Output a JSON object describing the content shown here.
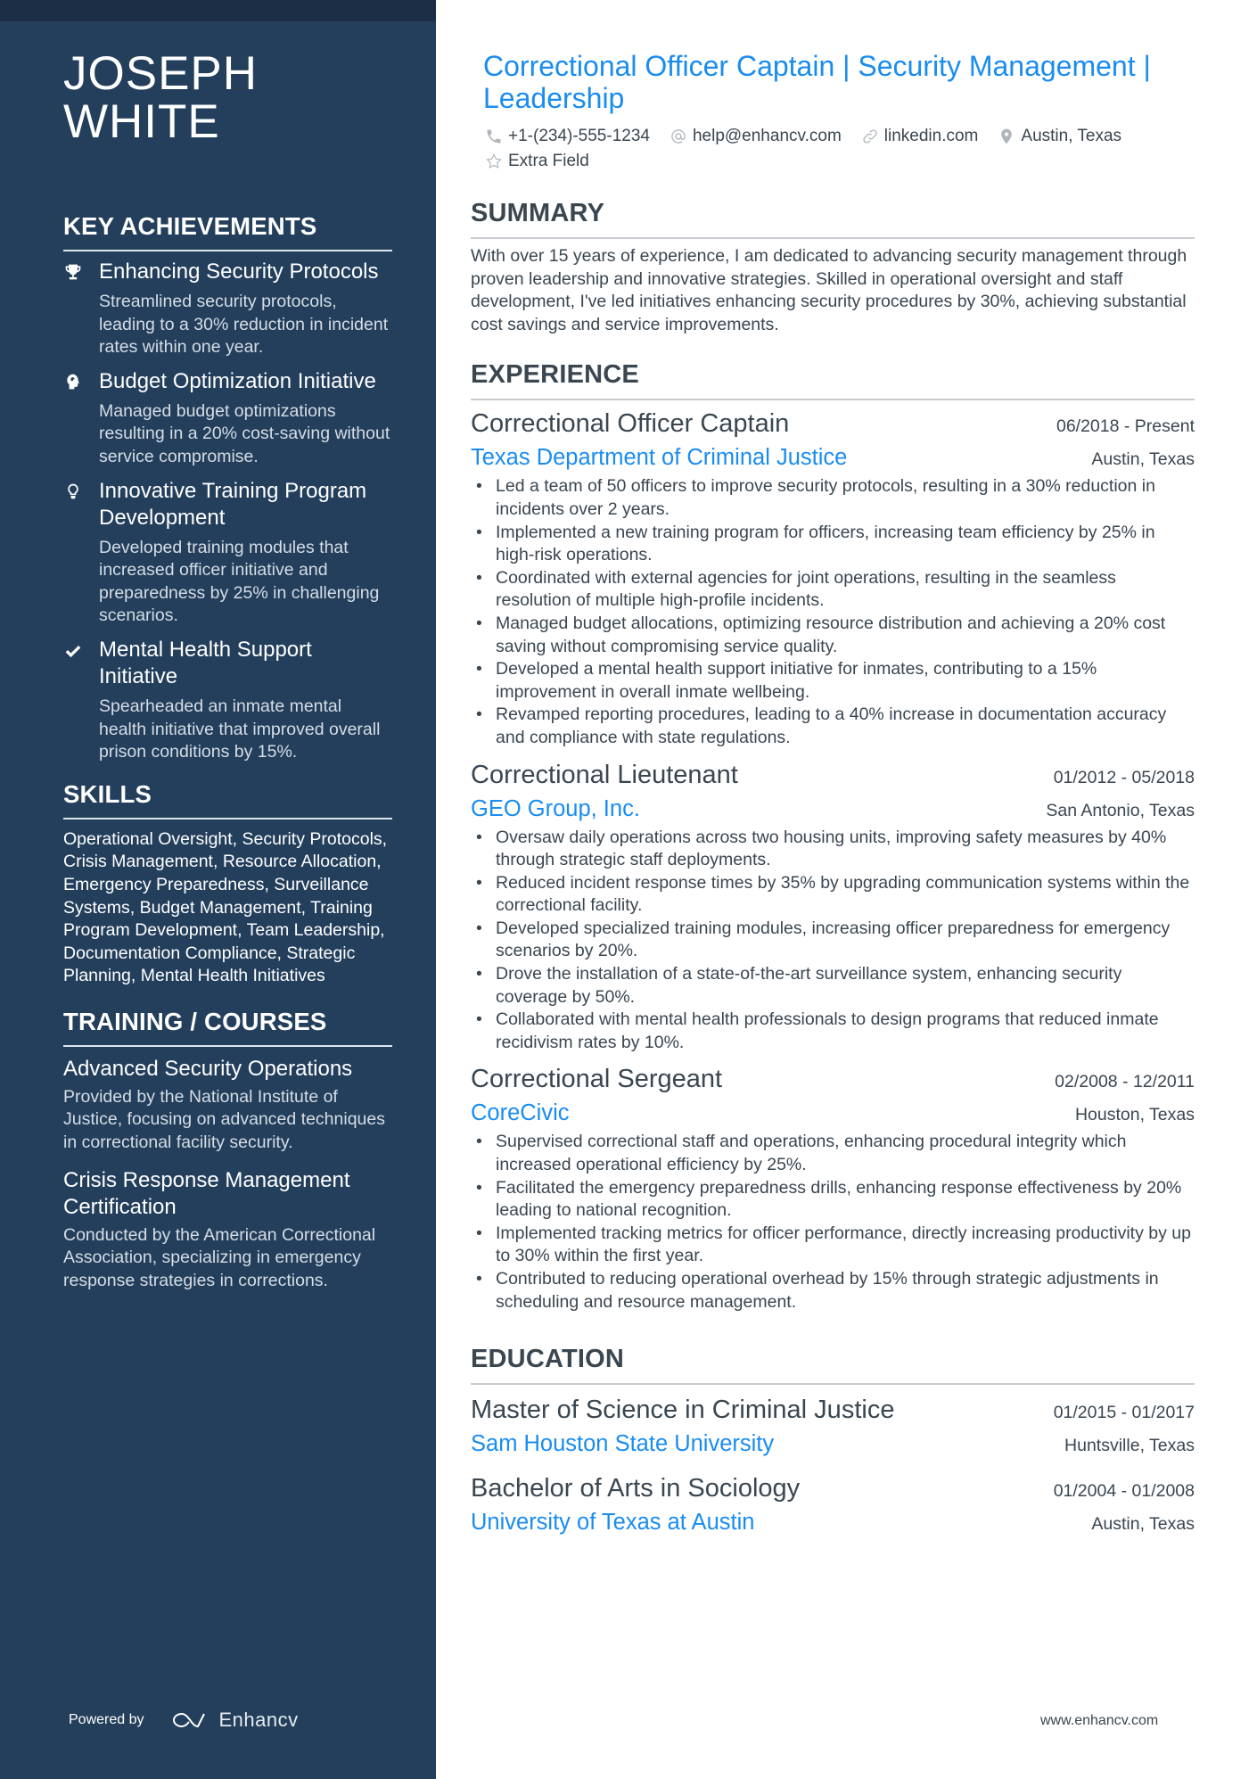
{
  "sidebar": {
    "name_line1": "JOSEPH",
    "name_line2": "WHITE",
    "achievements": {
      "heading": "KEY ACHIEVEMENTS",
      "items": [
        {
          "icon": "trophy-icon",
          "title": "Enhancing Security Protocols",
          "description": "Streamlined security protocols, leading to a 30% reduction in incident rates within one year."
        },
        {
          "icon": "head-icon",
          "title": "Budget Optimization Initiative",
          "description": "Managed budget optimizations resulting in a 20% cost-saving without service compromise."
        },
        {
          "icon": "lightbulb-icon",
          "title": "Innovative Training Program Development",
          "description": "Developed training modules that increased officer initiative and preparedness by 25% in challenging scenarios."
        },
        {
          "icon": "checkmark-icon",
          "title": "Mental Health Support Initiative",
          "description": "Spearheaded an inmate mental health initiative that improved overall prison conditions by 15%."
        }
      ]
    },
    "skills": {
      "heading": "SKILLS",
      "text": "Operational Oversight, Security Protocols, Crisis Management, Resource Allocation, Emergency Preparedness, Surveillance Systems, Budget Management, Training Program Development, Team Leadership, Documentation Compliance, Strategic Planning, Mental Health Initiatives"
    },
    "training": {
      "heading": "TRAINING / COURSES",
      "items": [
        {
          "title": "Advanced Security Operations",
          "description": "Provided by the National Institute of Justice, focusing on advanced techniques in correctional facility security."
        },
        {
          "title": "Crisis Response Management Certification",
          "description": "Conducted by the American Correctional Association, specializing in emergency response strategies in corrections."
        }
      ]
    },
    "footer": {
      "powered_by": "Powered by",
      "brand": "Enhancv"
    }
  },
  "header": {
    "headline": "Correctional Officer Captain | Security Management | Leadership",
    "contact": [
      {
        "icon": "phone-icon",
        "text": "+1-(234)-555-1234"
      },
      {
        "icon": "at-icon",
        "text": "help@enhancv.com"
      },
      {
        "icon": "link-icon",
        "text": "linkedin.com"
      },
      {
        "icon": "location-pin-icon",
        "text": "Austin, Texas"
      },
      {
        "icon": "star-icon",
        "text": "Extra Field"
      }
    ]
  },
  "summary": {
    "heading": "SUMMARY",
    "text": "With over 15 years of experience, I am dedicated to advancing security management through proven leadership and innovative strategies. Skilled in operational oversight and staff development, I've led initiatives enhancing security procedures by 30%, achieving substantial cost savings and service improvements."
  },
  "experience": {
    "heading": "EXPERIENCE",
    "jobs": [
      {
        "title": "Correctional Officer Captain",
        "dates": "06/2018 - Present",
        "company": "Texas Department of Criminal Justice",
        "location": "Austin, Texas",
        "bullets": [
          "Led a team of 50 officers to improve security protocols, resulting in a 30% reduction in incidents over 2 years.",
          "Implemented a new training program for officers, increasing team efficiency by 25% in high-risk operations.",
          "Coordinated with external agencies for joint operations, resulting in the seamless resolution of multiple high-profile incidents.",
          "Managed budget allocations, optimizing resource distribution and achieving a 20% cost saving without compromising service quality.",
          "Developed a mental health support initiative for inmates, contributing to a 15% improvement in overall inmate wellbeing.",
          "Revamped reporting procedures, leading to a 40% increase in documentation accuracy and compliance with state regulations."
        ]
      },
      {
        "title": "Correctional Lieutenant",
        "dates": "01/2012 - 05/2018",
        "company": "GEO Group, Inc.",
        "location": "San Antonio, Texas",
        "bullets": [
          "Oversaw daily operations across two housing units, improving safety measures by 40% through strategic staff deployments.",
          "Reduced incident response times by 35% by upgrading communication systems within the correctional facility.",
          "Developed specialized training modules, increasing officer preparedness for emergency scenarios by 20%.",
          "Drove the installation of a state-of-the-art surveillance system, enhancing security coverage by 50%.",
          "Collaborated with mental health professionals to design programs that reduced inmate recidivism rates by 10%."
        ]
      },
      {
        "title": "Correctional Sergeant",
        "dates": "02/2008 - 12/2011",
        "company": "CoreCivic",
        "location": "Houston, Texas",
        "bullets": [
          "Supervised correctional staff and operations, enhancing procedural integrity which increased operational efficiency by 25%.",
          "Facilitated the emergency preparedness drills, enhancing response effectiveness by 20% leading to national recognition.",
          "Implemented tracking metrics for officer performance, directly increasing productivity by up to 30% within the first year.",
          "Contributed to reducing operational overhead by 15% through strategic adjustments in scheduling and resource management."
        ]
      }
    ]
  },
  "education": {
    "heading": "EDUCATION",
    "items": [
      {
        "degree": "Master of Science in Criminal Justice",
        "dates": "01/2015 - 01/2017",
        "school": "Sam Houston State University",
        "location": "Huntsville, Texas"
      },
      {
        "degree": "Bachelor of Arts in Sociology",
        "dates": "01/2004 - 01/2008",
        "school": "University of Texas at Austin",
        "location": "Austin, Texas"
      }
    ]
  },
  "footer": {
    "url": "www.enhancv.com"
  },
  "colors": {
    "sidebar_bg": "#233f5c",
    "sidebar_topband": "#1c2e45",
    "accent_blue": "#1a8cf0",
    "body_text": "#3a4650"
  }
}
